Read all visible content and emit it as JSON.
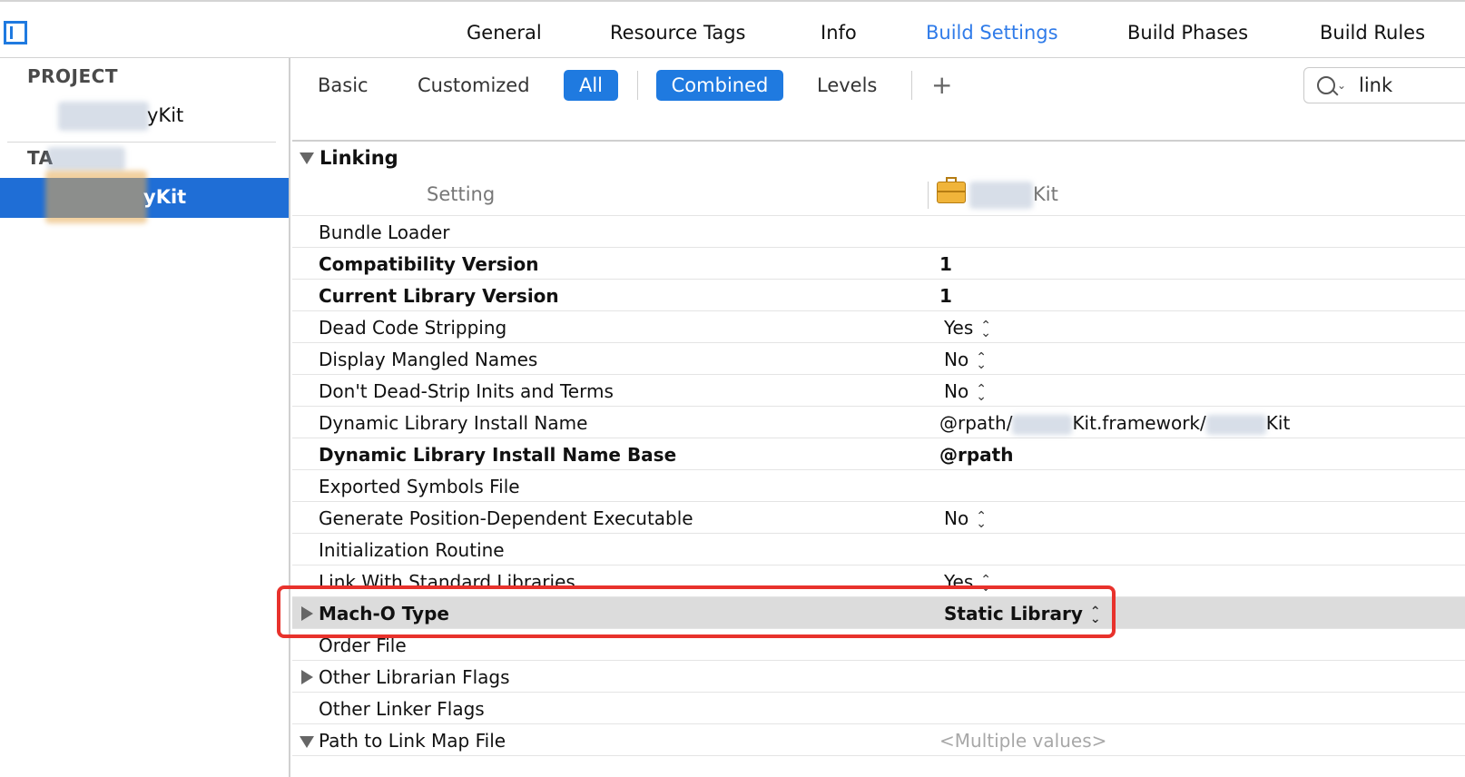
{
  "tabs": [
    {
      "label": "General",
      "active": false
    },
    {
      "label": "Resource Tags",
      "active": false
    },
    {
      "label": "Info",
      "active": false
    },
    {
      "label": "Build Settings",
      "active": true
    },
    {
      "label": "Build Phases",
      "active": false
    },
    {
      "label": "Build Rules",
      "active": false
    }
  ],
  "sidebar": {
    "project_header": "PROJECT",
    "project_item": "yKit",
    "targets_header": "TA",
    "target_item": "yKit"
  },
  "filter": {
    "basic": "Basic",
    "customized": "Customized",
    "all": "All",
    "combined": "Combined",
    "levels": "Levels",
    "add": "+"
  },
  "search": {
    "value": "link"
  },
  "section": {
    "title": "Linking",
    "setting_header": "Setting",
    "target_header": "Kit"
  },
  "rows": [
    {
      "name": "Bundle Loader",
      "value": "",
      "bold": false
    },
    {
      "name": "Compatibility Version",
      "value": "1",
      "bold": true
    },
    {
      "name": "Current Library Version",
      "value": "1",
      "bold": true
    },
    {
      "name": "Dead Code Stripping",
      "value": "Yes",
      "bold": false
    },
    {
      "name": "Display Mangled Names",
      "value": "No",
      "bold": false
    },
    {
      "name": "Don't Dead-Strip Inits and Terms",
      "value": "No",
      "bold": false
    },
    {
      "name": "Dynamic Library Install Name",
      "value": "@rpath/",
      "value2": "Kit.framework/",
      "value3": "Kit",
      "bold": false
    },
    {
      "name": "Dynamic Library Install Name Base",
      "value": "@rpath",
      "bold": true
    },
    {
      "name": "Exported Symbols File",
      "value": "",
      "bold": false
    },
    {
      "name": "Generate Position-Dependent Executable",
      "value": "No",
      "bold": false
    },
    {
      "name": "Initialization Routine",
      "value": "",
      "bold": false
    },
    {
      "name": "Link With Standard Libraries",
      "value": "Yes",
      "bold": false
    },
    {
      "name": "Mach-O Type",
      "value": "Static Library",
      "bold": true
    },
    {
      "name": "Order File",
      "value": "",
      "bold": false
    },
    {
      "name": "Other Librarian Flags",
      "value": "",
      "bold": false
    },
    {
      "name": "Other Linker Flags",
      "value": "",
      "bold": false
    },
    {
      "name": "Path to Link Map File",
      "value": "<Multiple values>",
      "bold": false
    }
  ],
  "colors": {
    "accent": "#1f7ae0",
    "callout": "#e8322c",
    "selection": "#1f6ed6"
  }
}
